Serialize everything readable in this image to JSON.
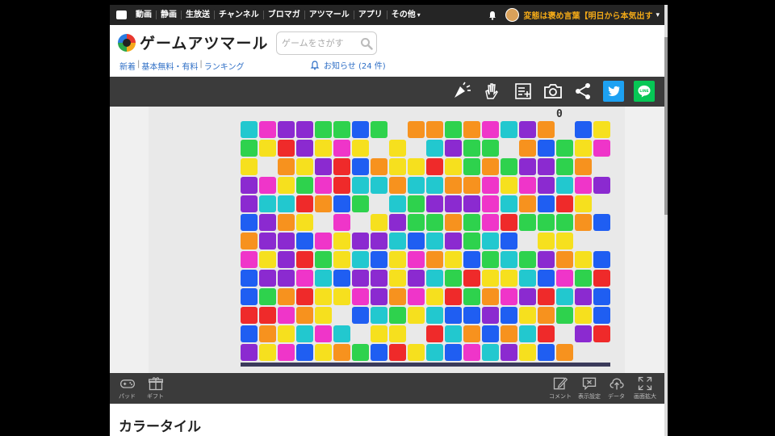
{
  "topnav": {
    "items": [
      "動画",
      "静画",
      "生放送",
      "チャンネル",
      "ブロマガ",
      "アツマール",
      "アプリ",
      "その他"
    ],
    "more_chevron": "▾",
    "username": "変態は褒め言葉【明日から本気出す",
    "user_chevron": "▾"
  },
  "header": {
    "brand": "ゲームアツマール",
    "search_placeholder": "ゲームをさがす",
    "links": [
      "新着",
      "基本無料・有料",
      "ランキング"
    ],
    "notice": "お知らせ (24 件)"
  },
  "toolbar": {
    "icons": [
      "applause-icon",
      "clap-icon",
      "playlist-add-icon",
      "camera-icon",
      "share-icon",
      "twitter-icon",
      "line-icon"
    ],
    "twitter_color": "#1da1f2",
    "line_color": "#06c755",
    "line_label": "LINE"
  },
  "game": {
    "title": "カラータイル",
    "score": "0",
    "palette": {
      "C": "#22c8cf",
      "M": "#ef35c9",
      "P": "#8b2ad0",
      "G": "#2ed24d",
      "B": "#1f5ef2",
      "O": "#f7921e",
      "Y": "#f6e01e",
      "R": "#ef2a2a",
      "L": "#ff2fa0"
    },
    "rows": [
      "CMPPGGBG.OOGOMCPO.BY",
      "GYRPYMY.Y.CPGG.OBGYM",
      "Y.OYPRBOYYRYGOGPPGO.",
      "PMYGMRCCOCCOOMYMPCMP",
      "PCCROBG.CGPPPMCOBRY.",
      "BPOY.M.YPGGOGMRGGGOB",
      "OPPBMYPPCBCPGCB.YY..",
      "MYPRGYCBYMOYBGCGPOYB",
      "BPPMCBPPYPCGRYYCBMGR",
      "BGORYYMPOMYRGOMPRCPB",
      "RRMOY.BCGYCBBPBYOGYB",
      "BOYCMC.YY.RCOBOCR.PR",
      "PYMBYOGBRYCBMCPYBO.."
    ]
  },
  "bottombar": {
    "left": [
      {
        "label": "パッド",
        "icon": "gamepad-icon"
      },
      {
        "label": "ギフト",
        "icon": "gift-icon"
      }
    ],
    "right": [
      {
        "label": "コメント",
        "icon": "comment-edit-icon"
      },
      {
        "label": "表示設定",
        "icon": "display-settings-icon"
      },
      {
        "label": "データ",
        "icon": "cloud-upload-icon"
      },
      {
        "label": "画面拡大",
        "icon": "fullscreen-icon"
      }
    ]
  }
}
